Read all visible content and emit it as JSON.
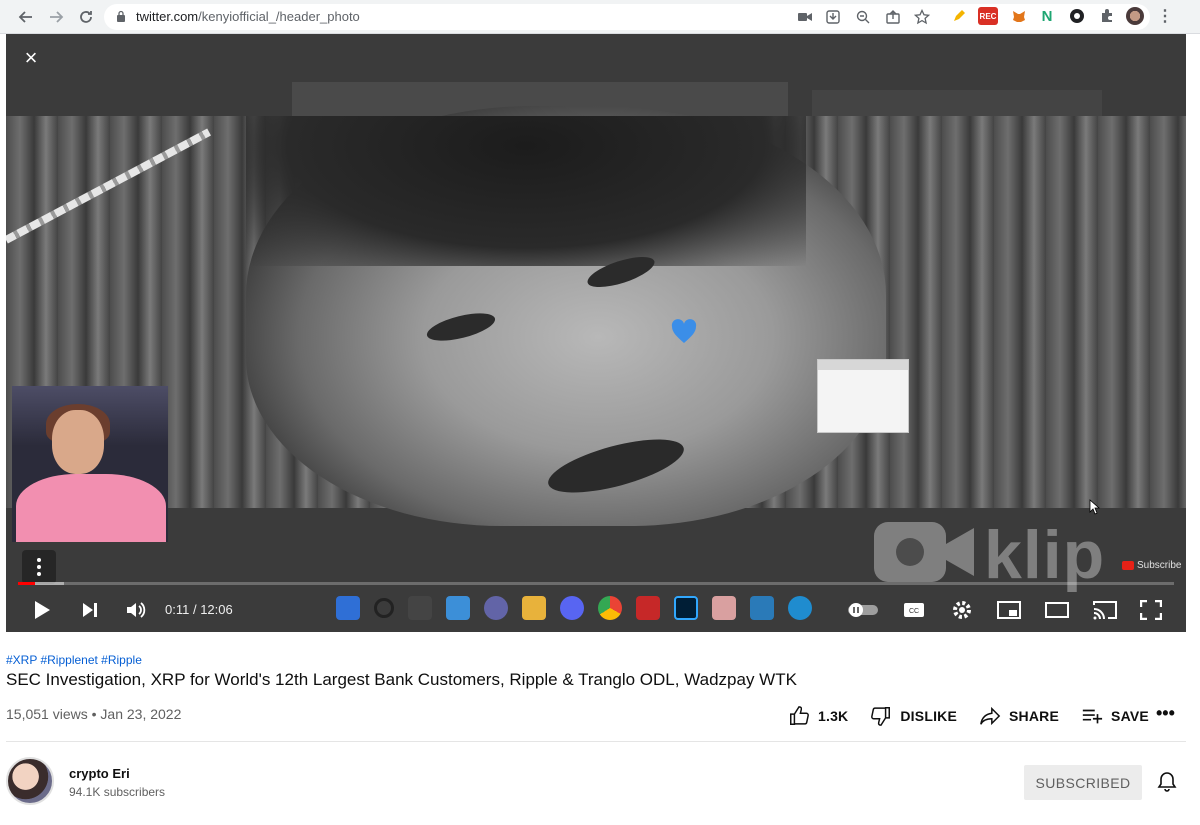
{
  "browser": {
    "url_domain": "twitter.com",
    "url_path": "/kenyiofficial_/header_photo",
    "rec_badge": "REC"
  },
  "player": {
    "close_label": "×",
    "watermark": "klip",
    "subscribe_badge": "Subscribe",
    "time_current": "0:11",
    "time_total": "12:06",
    "time_separator": " / ",
    "progress_played": 0.015,
    "progress_buffered": 0.04
  },
  "video": {
    "hashtags": "#XRP #Ripplenet #Ripple",
    "title": "SEC Investigation, XRP for World's 12th Largest Bank Customers, Ripple & Tranglo ODL, Wadzpay WTK",
    "views": "15,051 views",
    "date_separator": " • ",
    "date": "Jan 23, 2022"
  },
  "actions": {
    "like_count": "1.3K",
    "dislike_label": "DISLIKE",
    "share_label": "SHARE",
    "save_label": "SAVE",
    "more_label": "•••"
  },
  "channel": {
    "name": "crypto Eri",
    "subscribers": "94.1K subscribers",
    "subscribed_label": "SUBSCRIBED"
  },
  "colors": {
    "accent_link": "#065fd4",
    "progress_red": "#ff0000",
    "rec_red": "#d93025"
  }
}
